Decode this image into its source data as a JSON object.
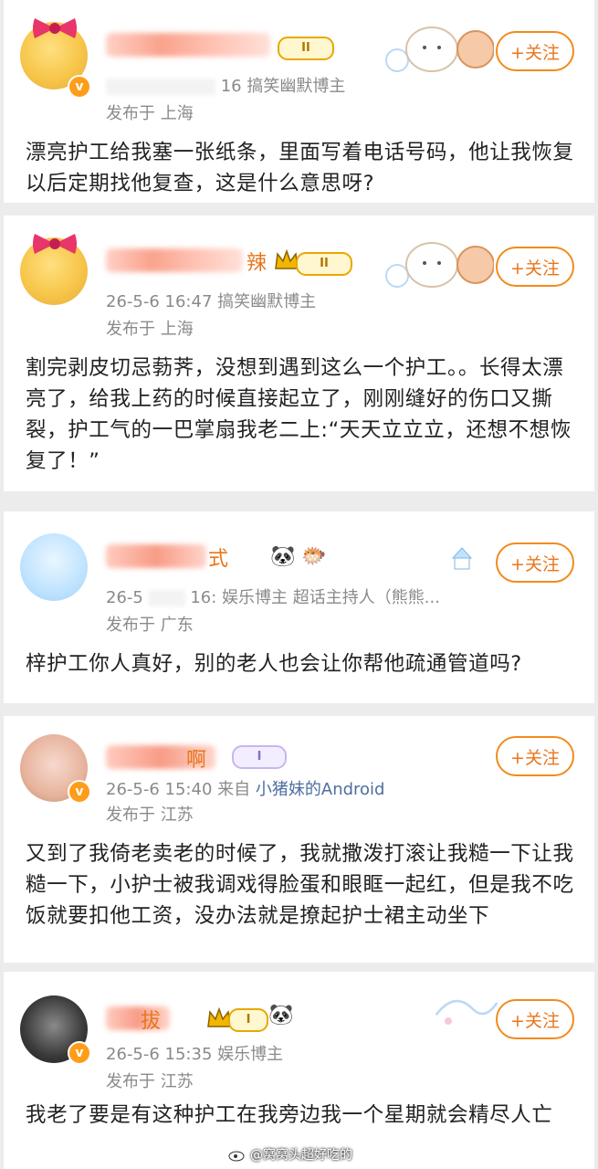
{
  "posts": [
    {
      "level": "II",
      "date": "",
      "time_tail": "16",
      "tag": "搞笑幽默博主",
      "location": "发布于 上海",
      "follow": "+关注",
      "content": "漂亮护工给我塞一张纸条，里面写着电话号码，他让我恢复以后定期找他复查，这是什么意思呀?"
    },
    {
      "name_tail": "辣",
      "level": "II",
      "date": "26-5-6 16:47",
      "tag": "搞笑幽默博主",
      "location": "发布于 上海",
      "follow": "+关注",
      "content": "割完剥皮切忌葧荠，没想到遇到这么一个护工。。长得太漂亮了，给我上药的时候直接起立了，刚刚缝好的伤口又撕裂，护工气的一巴掌扇我老二上:“天天立立立，还想不想恢复了！”"
    },
    {
      "name_tail": "式",
      "date": "26-5",
      "time_tail": "16:",
      "tag": "娱乐博主 超话主持人（熊熊...",
      "location": "发布于 广东",
      "follow": "+关注",
      "content": "梓护工你人真好，别的老人也会让你帮他疏通管道吗?"
    },
    {
      "name_tail": "啊",
      "level": "I",
      "date": "26-5-6 15:40",
      "source_prefix": "来自",
      "source": "小猪妹的Android",
      "location": "发布于 江苏",
      "follow": "+关注",
      "content": "又到了我倚老卖老的时候了，我就撒泼打滚让我糙一下让我糙一下，小护士被我调戏得脸蛋和眼眶一起红，但是我不吃饭就要扣他工资，没办法就是撩起护士裙主动坐下"
    },
    {
      "name_tail": "拔",
      "level": "I",
      "date": "26-5-6 15:35",
      "tag": "娱乐博主",
      "location": "发布于 江苏",
      "follow": "+关注",
      "content": "我老了要是有这种护工在我旁边我一个星期就会精尽人亡"
    }
  ],
  "watermark": "@窝窝头超好吃的",
  "colors": {
    "accent": "#f28b1d",
    "vip_badge": "#ff9d19",
    "meta_gray": "#8a8a8a",
    "link_blue": "#4d6ea0"
  }
}
